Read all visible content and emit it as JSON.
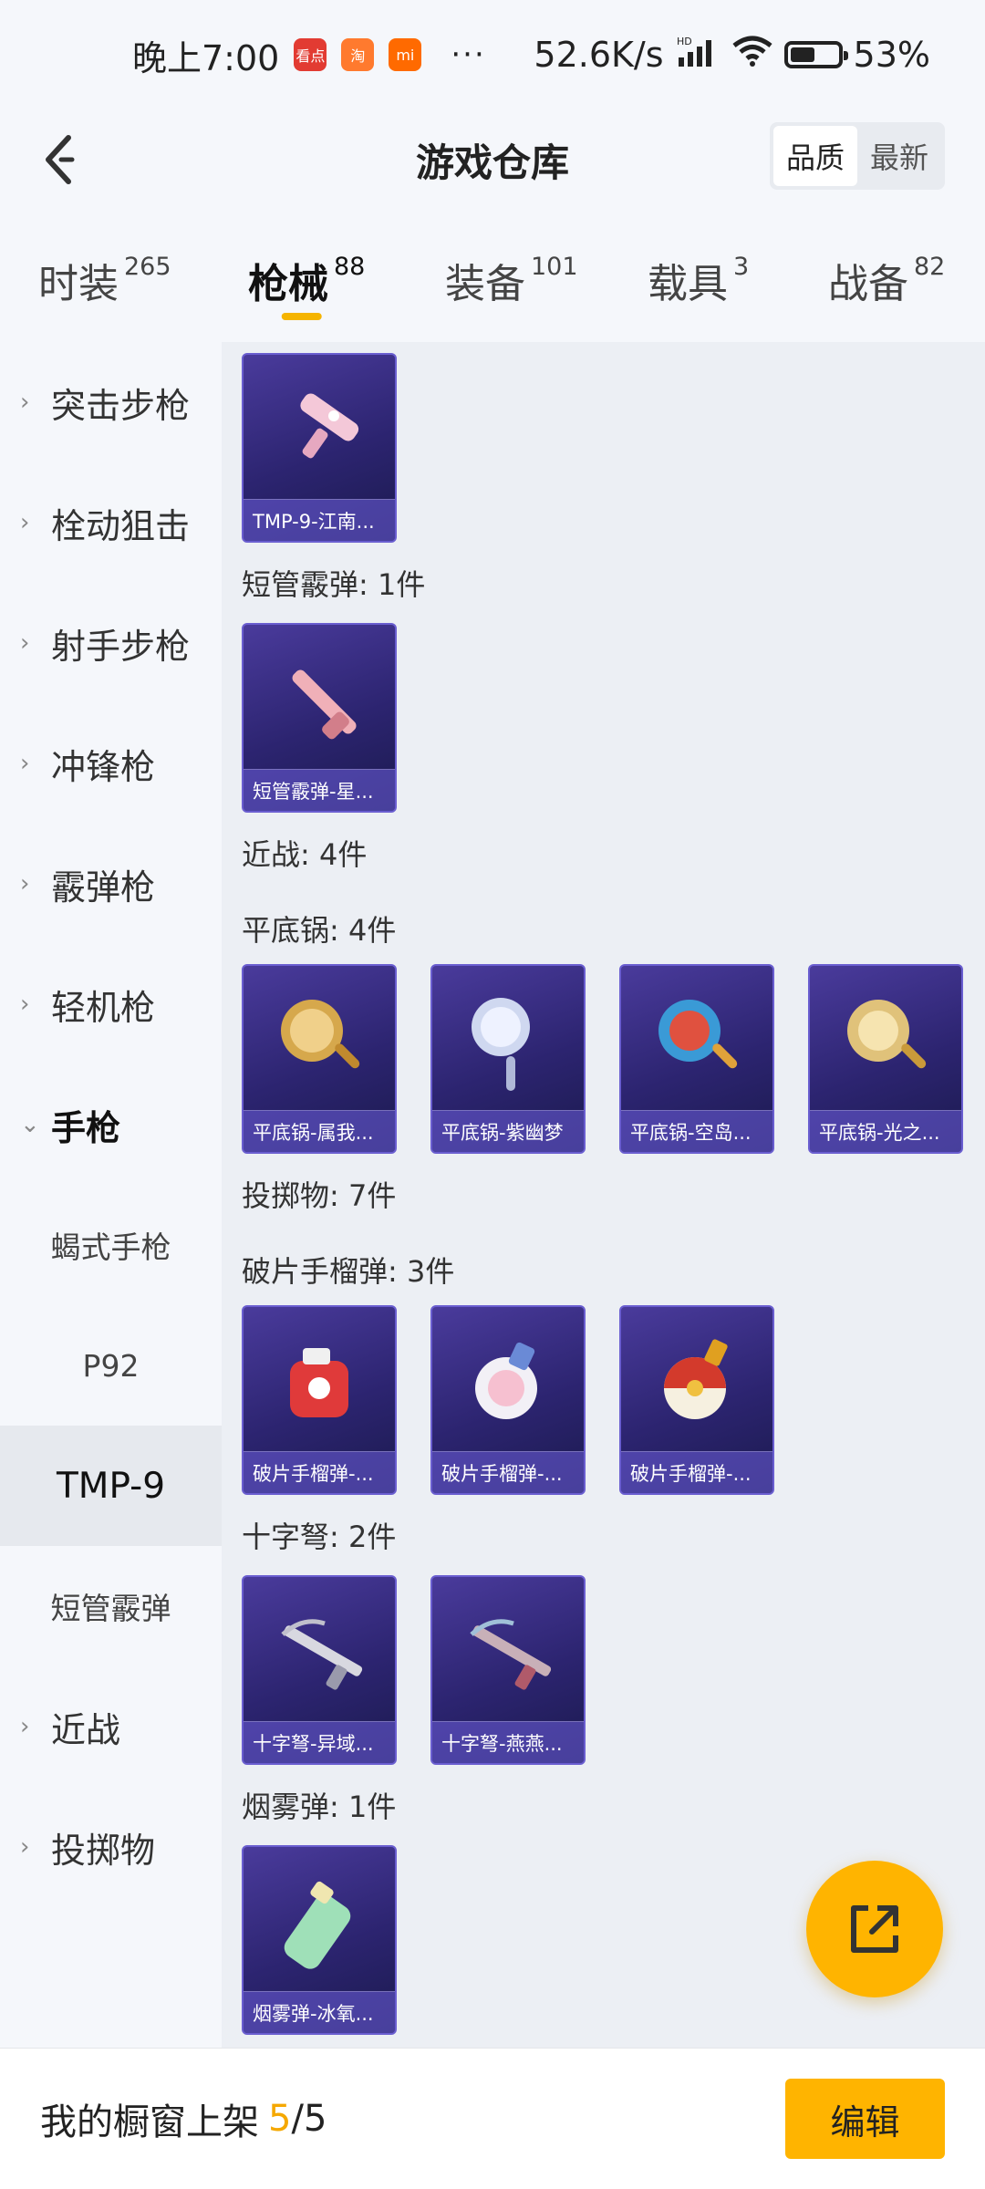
{
  "status_bar": {
    "time": "晚上7:00",
    "app_badges": [
      "看点",
      "淘",
      "mi"
    ],
    "overflow": "···",
    "network_speed": "52.6K/s",
    "hd_label": "HD",
    "battery": "53%",
    "battery_level": 0.53
  },
  "header": {
    "title": "游戏仓库",
    "sort_options": [
      "品质",
      "最新"
    ],
    "active_sort": "品质"
  },
  "category_tabs": [
    {
      "name": "时装",
      "count": "265"
    },
    {
      "name": "枪械",
      "count": "88",
      "active": true
    },
    {
      "name": "装备",
      "count": "101"
    },
    {
      "name": "载具",
      "count": "3"
    },
    {
      "name": "战备",
      "count": "82"
    }
  ],
  "sidebar": {
    "items": [
      {
        "label": "突击步枪"
      },
      {
        "label": "栓动狙击"
      },
      {
        "label": "射手步枪"
      },
      {
        "label": "冲锋枪"
      },
      {
        "label": "霰弹枪"
      },
      {
        "label": "轻机枪"
      },
      {
        "label": "手枪",
        "expanded": true
      }
    ],
    "sub_items": [
      "蝎式手枪",
      "P92",
      "TMP-9",
      "短管霰弹"
    ],
    "active_sub": "TMP-9",
    "items_after": [
      "近战",
      "投掷物"
    ]
  },
  "content": {
    "groups": [
      {
        "label": "",
        "cards": [
          "TMP-9-江南..."
        ]
      },
      {
        "label": "短管霰弹: 1件",
        "cards": [
          "短管霰弹-星..."
        ]
      },
      {
        "label": "近战: 4件",
        "cards": []
      },
      {
        "label": "平底锅: 4件",
        "cards": [
          "平底锅-属我...",
          "平底锅-紫幽梦",
          "平底锅-空岛...",
          "平底锅-光之..."
        ]
      },
      {
        "label": "投掷物: 7件",
        "cards": []
      },
      {
        "label": "破片手榴弹: 3件",
        "cards": [
          "破片手榴弹-...",
          "破片手榴弹-...",
          "破片手榴弹-..."
        ]
      },
      {
        "label": "十字弩: 2件",
        "cards": [
          "十字弩-异域...",
          "十字弩-燕燕..."
        ]
      },
      {
        "label": "烟雾弹: 1件",
        "cards": [
          "烟雾弹-冰氧..."
        ]
      }
    ]
  },
  "bottom_bar": {
    "label": "我的橱窗上架",
    "count": "5",
    "separator": "/",
    "total": "5",
    "edit_label": "编辑"
  },
  "colors": {
    "accent": "#ffb400",
    "card_bg": "#2c2470",
    "card_border": "#6a5ed0"
  }
}
